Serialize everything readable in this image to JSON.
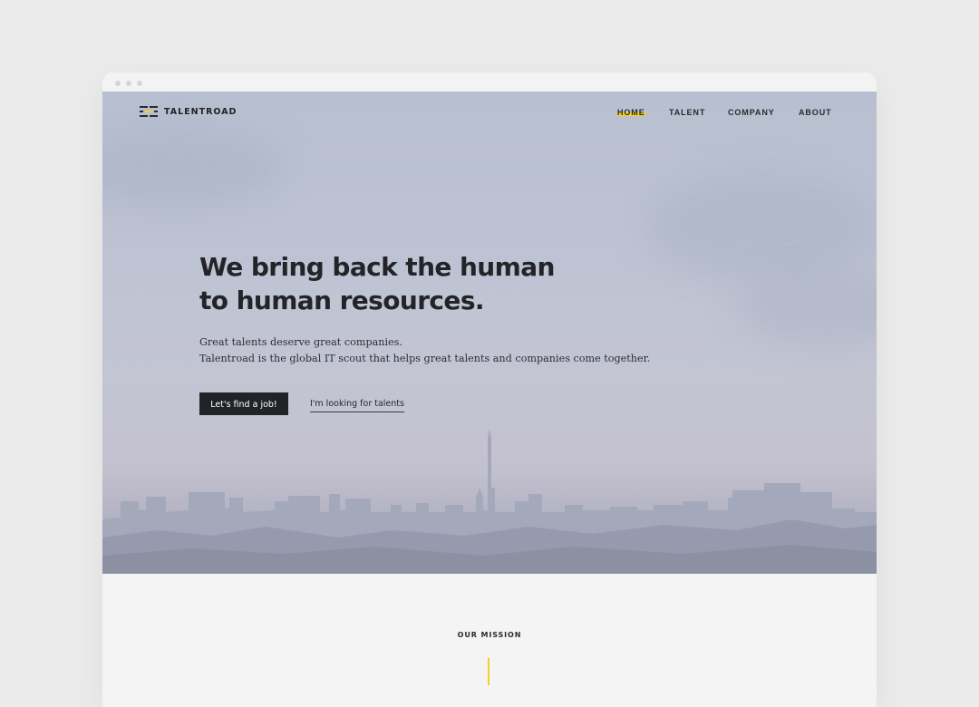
{
  "brand": {
    "name": "TALENTROAD",
    "accent_color": "#f3d21d",
    "dark_color": "#222326"
  },
  "nav": {
    "items": [
      {
        "label": "HOME",
        "active": true
      },
      {
        "label": "TALENT",
        "active": false
      },
      {
        "label": "COMPANY",
        "active": false
      },
      {
        "label": "ABOUT",
        "active": false
      }
    ]
  },
  "hero": {
    "headline_line1": "We bring back the human",
    "headline_line2": "to human resources.",
    "subtext_line1": "Great talents deserve great companies.",
    "subtext_line2": "Talentroad is the global IT scout that helps great talents and companies come together.",
    "primary_button": "Let's find a job!",
    "secondary_link": "I'm looking for talents"
  },
  "mission": {
    "label": "OUR MISSION"
  },
  "icons": {
    "logo": "talentroad-logo-icon",
    "window_controls": [
      "window-dot-icon",
      "window-dot-icon",
      "window-dot-icon"
    ]
  }
}
